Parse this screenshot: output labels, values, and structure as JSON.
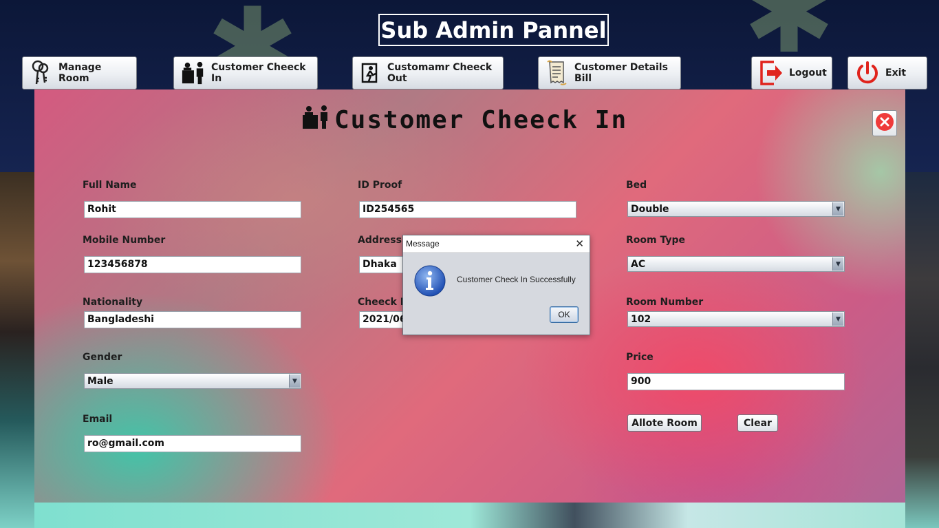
{
  "app": {
    "title": "Sub Admin Pannel"
  },
  "nav": {
    "manage_room": "Manage Room",
    "check_in": "Customer Cheeck In",
    "check_out": "Customamr Cheeck Out",
    "details_bill": "Customer Details Bill",
    "logout": "Logout",
    "exit": "Exit"
  },
  "form": {
    "title": "Customer Cheeck In",
    "full_name": {
      "label": "Full Name",
      "value": "Rohit"
    },
    "mobile": {
      "label": "Mobile Number",
      "value": "123456878"
    },
    "nationality": {
      "label": "Nationality",
      "value": "Bangladeshi"
    },
    "gender": {
      "label": "Gender",
      "value": "Male"
    },
    "email": {
      "label": "Email",
      "value": "ro@gmail.com"
    },
    "id_proof": {
      "label": "ID Proof",
      "value": "ID254565"
    },
    "address": {
      "label": "Address",
      "value": "Dhaka"
    },
    "checkin_date": {
      "label": "Cheeck In",
      "value": "2021/06"
    },
    "bed": {
      "label": "Bed",
      "value": "Double"
    },
    "room_type": {
      "label": "Room Type",
      "value": "AC"
    },
    "room_number": {
      "label": "Room Number",
      "value": "102"
    },
    "price": {
      "label": "Price",
      "value": "900"
    },
    "allote_btn": "Allote Room",
    "clear_btn": "Clear"
  },
  "dialog": {
    "title": "Message",
    "message": "Customer Check In Successfully",
    "ok": "OK"
  },
  "colors": {
    "exit_red": "#e0231c",
    "close_red": "#ef3b3b",
    "info_blue": "#2f64c6"
  },
  "icons": {
    "manage_room": "keys-icon",
    "check_in": "reception-icon",
    "check_out": "exit-person-icon",
    "details_bill": "receipt-icon",
    "logout": "logout-icon",
    "exit": "power-icon",
    "dialog": "info-icon"
  }
}
